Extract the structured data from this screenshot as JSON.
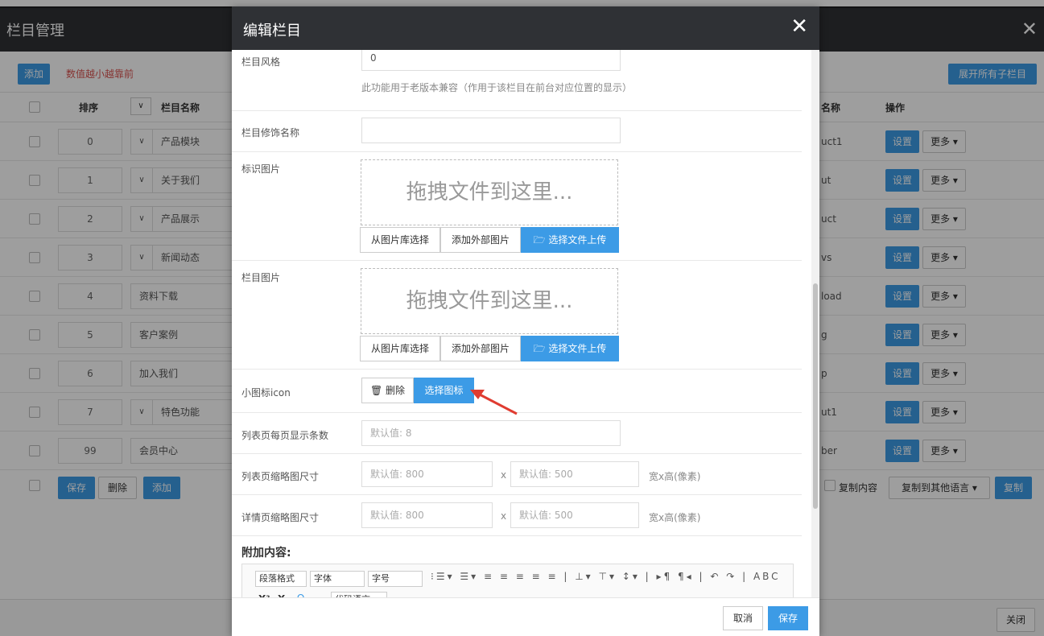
{
  "background": {
    "title": "栏目管理",
    "close_icon": "✕",
    "toolbar": {
      "add_label": "添加",
      "hint": "数值越小越靠前",
      "expand_label": "展开所有子栏目"
    },
    "headers": {
      "sort": "排序",
      "name": "栏目名称",
      "dirname": "名称",
      "ops": "操作"
    },
    "rows": [
      {
        "sort": "0",
        "name": "产品模块",
        "has_toggle": true,
        "dir": "uct1"
      },
      {
        "sort": "1",
        "name": "关于我们",
        "has_toggle": true,
        "dir": "ut"
      },
      {
        "sort": "2",
        "name": "产品展示",
        "has_toggle": true,
        "dir": "uct"
      },
      {
        "sort": "3",
        "name": "新闻动态",
        "has_toggle": true,
        "dir": "vs"
      },
      {
        "sort": "4",
        "name": "资料下载",
        "has_toggle": false,
        "dir": "load"
      },
      {
        "sort": "5",
        "name": "客户案例",
        "has_toggle": false,
        "dir": "g"
      },
      {
        "sort": "6",
        "name": "加入我们",
        "has_toggle": false,
        "dir": "p"
      },
      {
        "sort": "7",
        "name": "特色功能",
        "has_toggle": true,
        "dir": "ut1"
      },
      {
        "sort": "99",
        "name": "会员中心",
        "has_toggle": false,
        "dir": "ber"
      }
    ],
    "row_set_label": "设置",
    "row_more_label": "更多 ▾",
    "footer": {
      "save_label": "保存",
      "delete_label": "删除",
      "add_label": "添加",
      "copy_content_label": "复制内容",
      "copy_lang_label": "复制到其他语言 ▾",
      "copy_label": "复制"
    },
    "close_label": "关闭"
  },
  "modal": {
    "title": "编辑栏目",
    "close_icon": "✕",
    "style": {
      "label": "栏目风格",
      "value": "0",
      "hint": "此功能用于老版本兼容（作用于该栏目在前台对应位置的显示）"
    },
    "decor_name": {
      "label": "栏目修饰名称",
      "value": ""
    },
    "logo_image": {
      "label": "标识图片",
      "drop_text": "拖拽文件到这里...",
      "lib_label": "从图片库选择",
      "ext_label": "添加外部图片",
      "upload_label": "选择文件上传",
      "upload_icon": "folder-open-icon"
    },
    "column_image": {
      "label": "栏目图片",
      "drop_text": "拖拽文件到这里...",
      "lib_label": "从图片库选择",
      "ext_label": "添加外部图片",
      "upload_label": "选择文件上传",
      "upload_icon": "folder-open-icon"
    },
    "small_icon": {
      "label": "小图标icon",
      "delete_label": "删除",
      "pick_label": "选择图标",
      "delete_icon": "trash-icon"
    },
    "list_count": {
      "label": "列表页每页显示条数",
      "placeholder": "默认值: 8"
    },
    "list_thumb": {
      "label": "列表页缩略图尺寸",
      "w_placeholder": "默认值: 800",
      "x": "x",
      "h_placeholder": "默认值: 500",
      "unit": "宽x高(像素)"
    },
    "detail_thumb": {
      "label": "详情页缩略图尺寸",
      "w_placeholder": "默认值: 800",
      "x": "x",
      "h_placeholder": "默认值: 500",
      "unit": "宽x高(像素)"
    },
    "extra_title": "附加内容:",
    "editor": {
      "paragraph": "段落格式",
      "font": "字体",
      "size": "字号",
      "code_lang": "代码语言",
      "toolbar_glyphs": "⁝☰▾ ☰▾ ≡ ≡ ≡ ≡ ≡ | ⊥▾ ⊤▾ ↕▾ | ▸¶ ¶◂ | ↶ ↷ | ABC"
    },
    "footer": {
      "cancel_label": "取消",
      "save_label": "保存"
    }
  },
  "colors": {
    "accent": "#3c9be6",
    "header": "#2f3135",
    "hint_red": "#d9534f",
    "arrow": "#e03c31"
  }
}
